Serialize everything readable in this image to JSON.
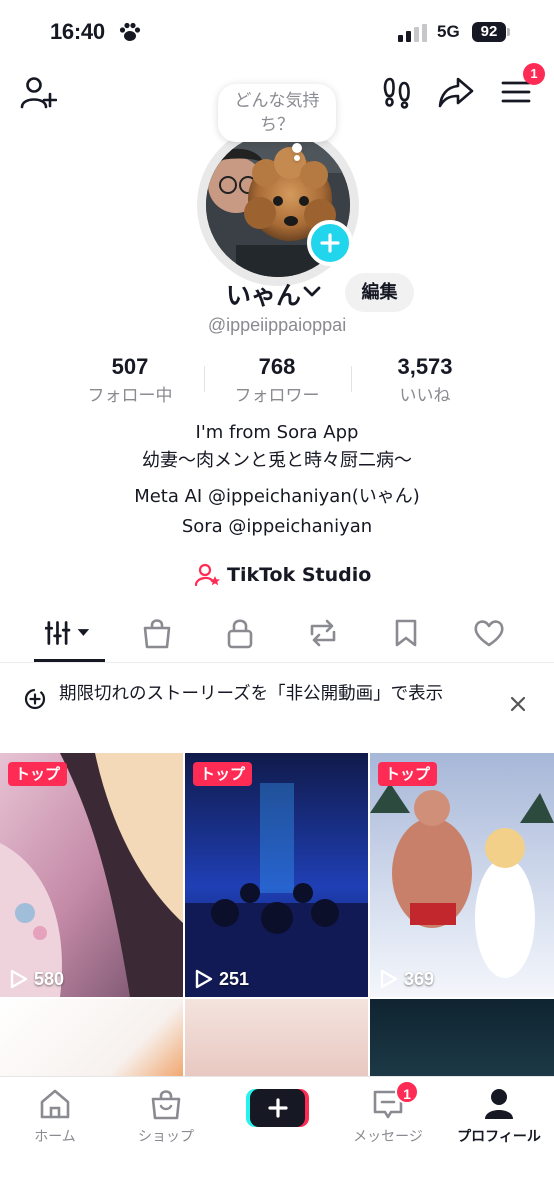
{
  "status_bar": {
    "time": "16:40",
    "network": "5G",
    "battery": "92"
  },
  "header": {
    "menu_badge": "1"
  },
  "profile": {
    "mood_prompt": "どんな気持ち？",
    "display_name": "いゃん",
    "edit_label": "編集",
    "username": "@ippeiippaioppai"
  },
  "stats": [
    {
      "value": "507",
      "label": "フォロー中"
    },
    {
      "value": "768",
      "label": "フォロワー"
    },
    {
      "value": "3,573",
      "label": "いいね"
    }
  ],
  "bio": {
    "line1": "I'm from Sora App",
    "line2": "幼妻〜肉メンと兎と時々厨二病〜",
    "line3": "Meta AI @ippeichaniyan(いゃん)",
    "line4": "Sora @ippeichaniyan"
  },
  "studio_link": "TikTok Studio",
  "tabs": [
    "videos-grid",
    "shop",
    "private",
    "reposts",
    "favorites",
    "liked"
  ],
  "stories_banner": {
    "text": "期限切れのストーリーズを「非公開動画」で表示"
  },
  "videos": [
    {
      "badge": "トップ",
      "views": "580"
    },
    {
      "badge": "トップ",
      "views": "251"
    },
    {
      "badge": "トップ",
      "views": "369"
    }
  ],
  "bottom_nav": {
    "home": "ホーム",
    "shop": "ショップ",
    "inbox": "メッセージ",
    "inbox_badge": "1",
    "profile": "プロフィール"
  },
  "colors": {
    "accent": "#fe2c55",
    "cyan": "#25f4ee",
    "text": "#161823",
    "muted": "#8a8b91"
  }
}
